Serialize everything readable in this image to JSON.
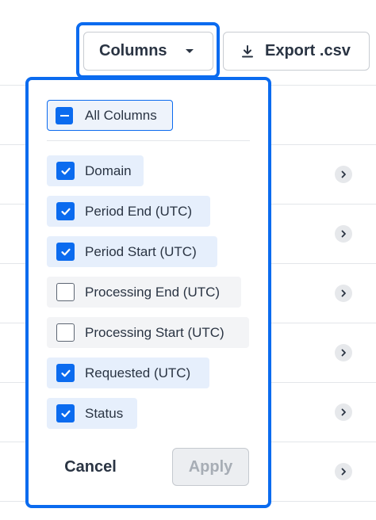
{
  "toolbar": {
    "columns_label": "Columns",
    "export_label": "Export .csv"
  },
  "column_picker": {
    "all_columns": {
      "label": "All Columns",
      "state": "indeterminate"
    },
    "options": [
      {
        "label": "Domain",
        "checked": true
      },
      {
        "label": "Period End (UTC)",
        "checked": true
      },
      {
        "label": "Period Start (UTC)",
        "checked": true
      },
      {
        "label": "Processing End (UTC)",
        "checked": false
      },
      {
        "label": "Processing Start (UTC)",
        "checked": false
      },
      {
        "label": "Requested (UTC)",
        "checked": true
      },
      {
        "label": "Status",
        "checked": true
      }
    ],
    "cancel_label": "Cancel",
    "apply_label": "Apply",
    "apply_enabled": false
  },
  "colors": {
    "accent": "#0b6bef",
    "checked_bg": "#e6effc",
    "unchecked_bg": "#f3f4f6",
    "text": "#2a3443"
  },
  "icons": {
    "caret": "caret-down-icon",
    "download": "download-icon",
    "check": "check-icon",
    "minus": "minus-icon",
    "row_expand": "chevron-right-icon"
  }
}
